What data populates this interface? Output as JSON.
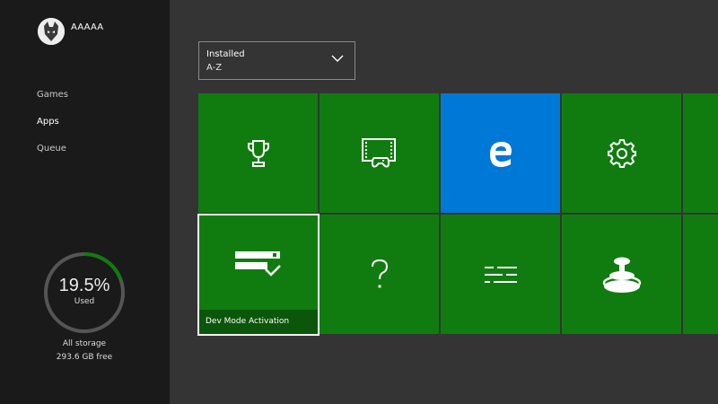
{
  "profile": {
    "gamertag": "AAAAA"
  },
  "nav": {
    "items": [
      {
        "label": "Games"
      },
      {
        "label": "Apps"
      },
      {
        "label": "Queue"
      }
    ]
  },
  "storage": {
    "percent_used": "19.5%",
    "used_label": "Used",
    "scope_label": "All storage",
    "free_label": "293.6 GB free",
    "used_fraction": 0.195
  },
  "filter": {
    "line1": "Installed",
    "line2": "A-Z"
  },
  "tiles": [
    {
      "icon": "trophy-icon"
    },
    {
      "icon": "game-dvr-icon"
    },
    {
      "icon": "edge-icon"
    },
    {
      "icon": "settings-gear-icon"
    },
    {
      "icon": "partial-tile"
    },
    {
      "icon": "dev-mode-icon",
      "label": "Dev Mode Activation"
    },
    {
      "icon": "question-mark-icon"
    },
    {
      "icon": "lines-icon"
    },
    {
      "icon": "joystick-icon"
    },
    {
      "icon": "partial-tile"
    }
  ],
  "colors": {
    "accent_green": "#107c10",
    "tile_blue": "#0078d7",
    "sidebar_bg": "#1a1a1a",
    "background": "#343434"
  }
}
